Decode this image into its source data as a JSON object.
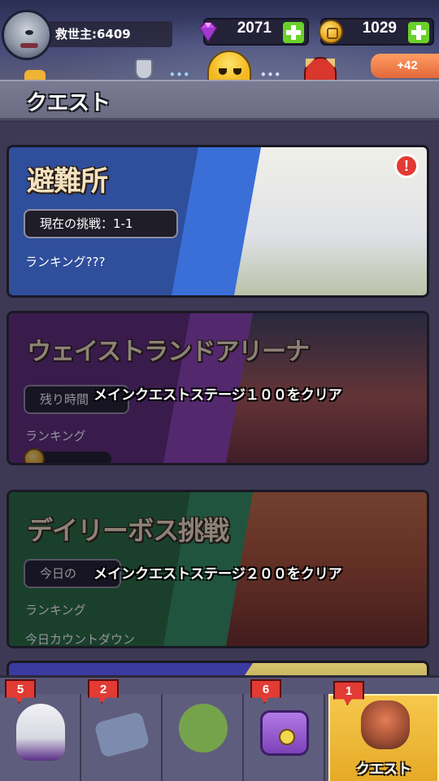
{
  "topbar": {
    "player_name": "救世主:6409",
    "gems": "2071",
    "coins": "1029",
    "bonus": "+42",
    "dots_left": "•••",
    "dots_right": "•••"
  },
  "header": {
    "title": "クエスト"
  },
  "quests": [
    {
      "title": "避難所",
      "pill": "現在の挑戦：1-1",
      "ranking": "ランキング???",
      "alert": "!",
      "locked": false
    },
    {
      "title": "ウェイストランドアリーナ",
      "pill": "残り時間",
      "ranking": "ランキング",
      "lock_message": "メインクエストステージ１００をクリア",
      "locked": true
    },
    {
      "title": "デイリーボス挑戦",
      "pill": "今日の",
      "ranking": "ランキング",
      "countdown": "今日カウントダウン",
      "lock_message": "メインクエストステージ２００をクリア",
      "locked": true
    }
  ],
  "nav": {
    "tabs": [
      {
        "name": "heroes",
        "badge": "5",
        "icon": "rabbit-hero-icon"
      },
      {
        "name": "weapons",
        "badge": "2",
        "icon": "gun-icon"
      },
      {
        "name": "battle",
        "badge": "",
        "icon": "zombie-target-icon"
      },
      {
        "name": "shop",
        "badge": "6",
        "icon": "chest-icon"
      },
      {
        "name": "quest",
        "badge": "1",
        "icon": "quest-icon",
        "label": "クエスト",
        "active": true
      }
    ]
  },
  "colors": {
    "gem": "#c74df0",
    "coin": "#e6a51d",
    "plus": "#6ad12b",
    "badge": "#e13b33",
    "active_tab": "#f6c84d"
  }
}
